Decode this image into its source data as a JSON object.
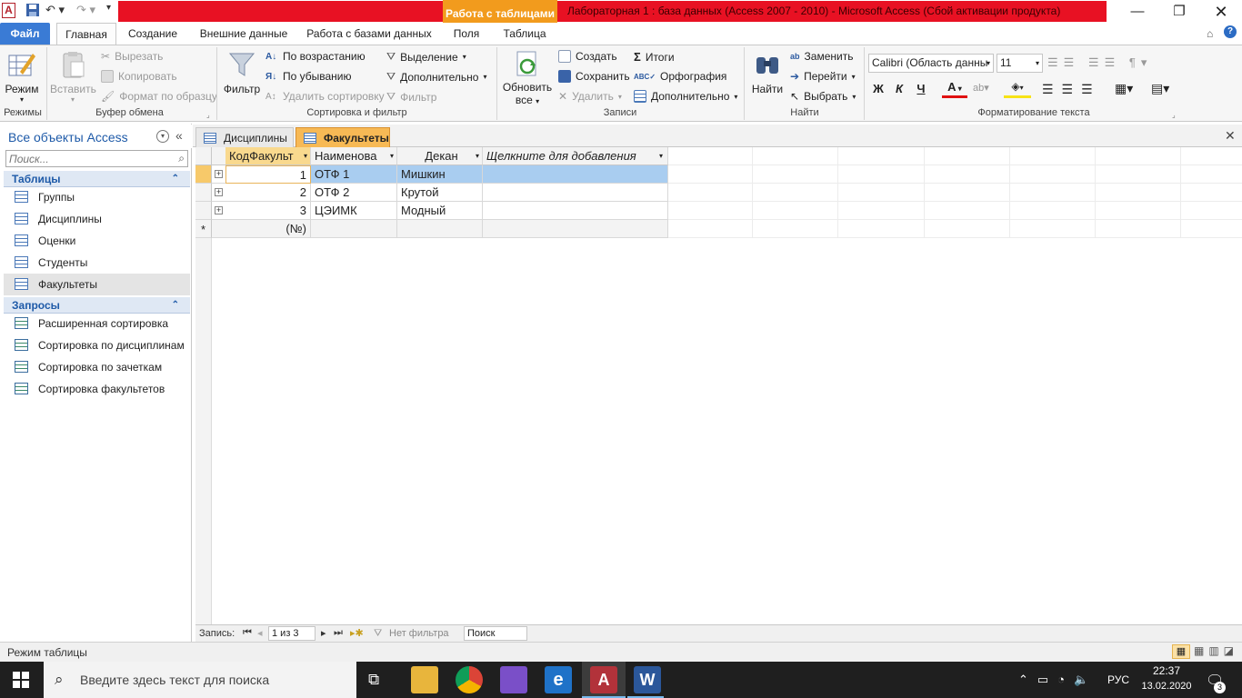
{
  "titlebar": {
    "context_tab": "Работа с таблицами",
    "title": "Лабораторная 1 : база данных (Access 2007 - 2010)  -  Microsoft Access (Сбой активации продукта)",
    "app_letter": "A"
  },
  "tabs": {
    "file": "Файл",
    "home": "Главная",
    "create": "Создание",
    "external": "Внешние данные",
    "database": "Работа с базами данных",
    "fields": "Поля",
    "table": "Таблица"
  },
  "ribbon": {
    "views": {
      "mode": "Режим",
      "label": "Режимы"
    },
    "clipboard": {
      "paste": "Вставить",
      "cut": "Вырезать",
      "copy": "Копировать",
      "format_painter": "Формат по образцу",
      "label": "Буфер обмена"
    },
    "sort_filter": {
      "filter": "Фильтр",
      "asc": "По возрастанию",
      "desc": "По убыванию",
      "remove_sort": "Удалить сортировку",
      "selection": "Выделение",
      "advanced": "Дополнительно",
      "toggle_filter": "Фильтр",
      "label": "Сортировка и фильтр"
    },
    "records": {
      "refresh_all_1": "Обновить",
      "refresh_all_2": "все",
      "new": "Создать",
      "save": "Сохранить",
      "delete": "Удалить",
      "totals": "Итоги",
      "spelling": "Орфография",
      "more": "Дополнительно",
      "label": "Записи"
    },
    "find": {
      "find": "Найти",
      "replace": "Заменить",
      "goto": "Перейти",
      "select": "Выбрать",
      "label": "Найти"
    },
    "text_format": {
      "font": "Calibri (Область данны",
      "size": "11",
      "bold": "Ж",
      "italic": "К",
      "underline": "Ч",
      "label": "Форматирование текста"
    }
  },
  "nav": {
    "header": "Все объекты Access",
    "search_placeholder": "Поиск...",
    "tables_label": "Таблицы",
    "tables": [
      "Группы",
      "Дисциплины",
      "Оценки",
      "Студенты",
      "Факультеты"
    ],
    "queries_label": "Запросы",
    "queries": [
      "Расширенная сортировка",
      "Сортировка по дисциплинам",
      "Сортировка по зачеткам",
      "Сортировка факультетов"
    ]
  },
  "doc_tabs": [
    "Дисциплины",
    "Факультеты"
  ],
  "grid": {
    "columns": [
      "КодФакульт",
      "Наименова",
      "Декан",
      "Щелкните для добавления"
    ],
    "rows": [
      {
        "id": "1",
        "name": "ОТФ 1",
        "dean": "Мишкин"
      },
      {
        "id": "2",
        "name": "ОТФ 2",
        "dean": "Крутой"
      },
      {
        "id": "3",
        "name": "ЦЭИМК",
        "dean": "Модный"
      }
    ],
    "new_row_marker": "*",
    "new_row_id": "(№)"
  },
  "record_nav": {
    "label": "Запись:",
    "position": "1 из 3",
    "filter": "Нет фильтра",
    "search": "Поиск"
  },
  "status": {
    "mode": "Режим таблицы"
  },
  "taskbar": {
    "search_placeholder": "Введите здесь текст для поиска",
    "lang": "РУС",
    "time": "22:37",
    "date": "13.02.2020",
    "notifications": "3"
  },
  "colors": {
    "accent": "#e81123",
    "context": "#f29b1d",
    "file_tab": "#3a7bd5",
    "selected_row": "#a9cdf0"
  }
}
